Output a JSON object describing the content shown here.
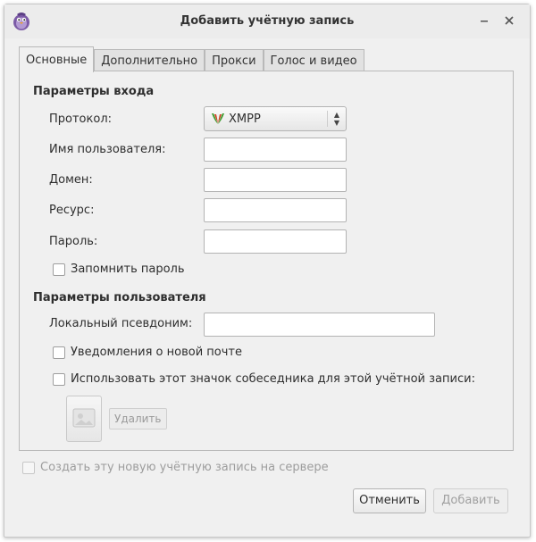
{
  "window": {
    "title": "Добавить учётную запись",
    "minimize_icon": "minimize-icon",
    "close_icon": "close-icon"
  },
  "tabs": [
    {
      "label": "Основные",
      "active": true
    },
    {
      "label": "Дополнительно",
      "active": false
    },
    {
      "label": "Прокси",
      "active": false
    },
    {
      "label": "Голос и видео",
      "active": false
    }
  ],
  "login": {
    "section_title": "Параметры входа",
    "protocol_label": "Протокол:",
    "protocol_value": "XMPP",
    "username_label": "Имя пользователя:",
    "username_value": "",
    "domain_label": "Домен:",
    "domain_value": "",
    "resource_label": "Ресурс:",
    "resource_value": "",
    "password_label": "Пароль:",
    "password_value": "",
    "remember_password_label": "Запомнить пароль",
    "remember_password_checked": false
  },
  "user": {
    "section_title": "Параметры пользователя",
    "alias_label": "Локальный псевдоним:",
    "alias_value": "",
    "new_mail_label": "Уведомления о новой почте",
    "new_mail_checked": false,
    "buddy_icon_label": "Использовать этот значок собеседника для этой учётной записи:",
    "buddy_icon_checked": false,
    "remove_label": "Удалить"
  },
  "footer": {
    "create_on_server_label": "Создать эту новую учётную запись на сервере",
    "create_on_server_checked": false,
    "cancel_label": "Отменить",
    "add_label": "Добавить"
  },
  "colors": {
    "window_bg": "#f0f0f0",
    "xmpp_icon_green": "#3a9a2c",
    "xmpp_icon_red": "#d04020"
  }
}
